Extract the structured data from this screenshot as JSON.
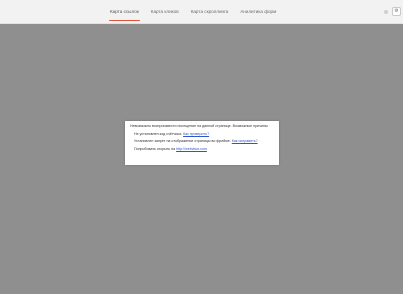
{
  "tabs": [
    {
      "label": "Карта ссылок",
      "active": true
    },
    {
      "label": "Карта кликов",
      "active": false
    },
    {
      "label": "Карта скроллинга",
      "active": false
    },
    {
      "label": "Аналитика форм",
      "active": false
    }
  ],
  "dialog": {
    "message": "Невозможно воспроизвести посещение на данной странице. Возможные причины:",
    "reason1_text": "Не установлен код счётчика.",
    "reason1_link": "Как проверить?",
    "reason2_text": "Установлен запрет на отображение страницы во фрейме.",
    "reason2_link": "Как исправить?",
    "reason3_text": "Попробовать открыть на",
    "reason3_link": "http://webvisor.com"
  },
  "colors": {
    "overlay": "#8f8f8f",
    "active_tab_underline": "#e0533b",
    "link": "#2f56c8"
  }
}
